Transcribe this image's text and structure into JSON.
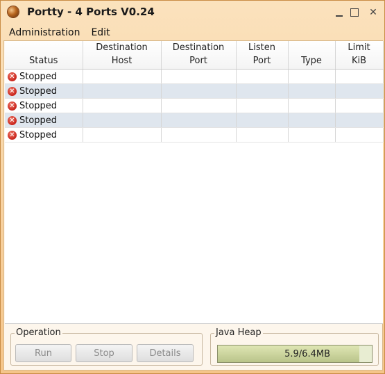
{
  "window": {
    "title": "Portty - 4 Ports V0.24"
  },
  "menu": [
    {
      "label": "Administration"
    },
    {
      "label": "Edit"
    }
  ],
  "table": {
    "columns": [
      {
        "line1": "",
        "line2": "Status"
      },
      {
        "line1": "Destination",
        "line2": "Host"
      },
      {
        "line1": "Destination",
        "line2": "Port"
      },
      {
        "line1": "Listen",
        "line2": "Port"
      },
      {
        "line1": "",
        "line2": "Type"
      },
      {
        "line1": "Limit",
        "line2": "KiB"
      }
    ],
    "rows": [
      {
        "status": "Stopped",
        "host": "",
        "dest_port": "",
        "listen_port": "",
        "type": "",
        "limit": ""
      },
      {
        "status": "Stopped",
        "host": "",
        "dest_port": "",
        "listen_port": "",
        "type": "",
        "limit": ""
      },
      {
        "status": "Stopped",
        "host": "",
        "dest_port": "",
        "listen_port": "",
        "type": "",
        "limit": ""
      },
      {
        "status": "Stopped",
        "host": "",
        "dest_port": "",
        "listen_port": "",
        "type": "",
        "limit": ""
      },
      {
        "status": "Stopped",
        "host": "",
        "dest_port": "",
        "listen_port": "",
        "type": "",
        "limit": ""
      }
    ]
  },
  "operation": {
    "label": "Operation",
    "run_label": "Run",
    "stop_label": "Stop",
    "details_label": "Details"
  },
  "heap": {
    "label": "Java Heap",
    "text": "5.9/6.4MB",
    "fill_fraction": 0.92
  },
  "colors": {
    "title_gradient_top": "#fbe2bd",
    "title_gradient_bottom": "#f5c58a",
    "row_alt": "#dfe6ee",
    "status_icon": "#c8231b"
  }
}
